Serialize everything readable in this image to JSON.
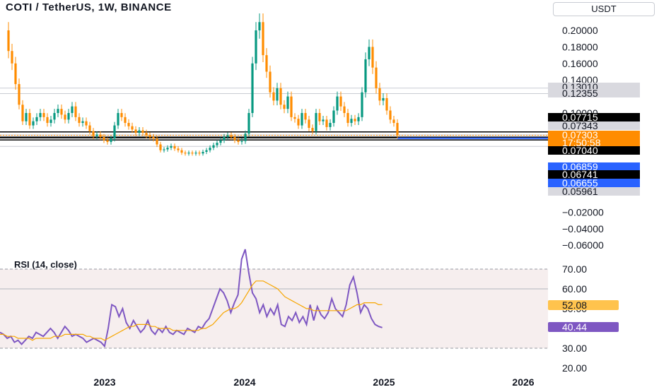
{
  "header": {
    "title": "COTI / TetherUS, 1W, BINANCE",
    "currency": "USDT"
  },
  "rsi": {
    "title": "RSI (14, close)"
  },
  "chart_data": [
    {
      "type": "candlestick",
      "title": "COTI / TetherUS, 1W, BINANCE",
      "ylabel": "USDT",
      "ylim": [
        -0.06,
        0.21
      ],
      "y_ticks": [
        "0.20000",
        "0.18000",
        "0.16000",
        "0.14000",
        "0.10000",
        "−0.02000",
        "−0.04000",
        "−0.06000"
      ],
      "x_ticks": [
        "2023",
        "2024",
        "2025",
        "2026"
      ],
      "up_color": "#089981",
      "down_color": "#ff8c00",
      "weekly_close": [
        0.175,
        0.16,
        0.135,
        0.11,
        0.09,
        0.1,
        0.085,
        0.09,
        0.095,
        0.1,
        0.095,
        0.088,
        0.092,
        0.1,
        0.105,
        0.098,
        0.092,
        0.1,
        0.108,
        0.095,
        0.088,
        0.09,
        0.085,
        0.078,
        0.072,
        0.074,
        0.071,
        0.067,
        0.065,
        0.069,
        0.085,
        0.1,
        0.095,
        0.088,
        0.084,
        0.08,
        0.076,
        0.079,
        0.076,
        0.073,
        0.071,
        0.069,
        0.062,
        0.055,
        0.056,
        0.058,
        0.06,
        0.057,
        0.055,
        0.052,
        0.051,
        0.052,
        0.051,
        0.052,
        0.051,
        0.053,
        0.055,
        0.058,
        0.061,
        0.064,
        0.067,
        0.071,
        0.073,
        0.071,
        0.067,
        0.065,
        0.066,
        0.075,
        0.1,
        0.16,
        0.2,
        0.21,
        0.17,
        0.15,
        0.125,
        0.115,
        0.13,
        0.11,
        0.105,
        0.12,
        0.095,
        0.093,
        0.085,
        0.1,
        0.092,
        0.082,
        0.078,
        0.1,
        0.09,
        0.092,
        0.083,
        0.088,
        0.103,
        0.12,
        0.108,
        0.1,
        0.088,
        0.093,
        0.09,
        0.095,
        0.125,
        0.165,
        0.18,
        0.155,
        0.13,
        0.115,
        0.118,
        0.103,
        0.092,
        0.088,
        0.073
      ],
      "horizontal_levels": [
        {
          "value": "0.13010",
          "color": "#d9d9df",
          "text_color": "#131722"
        },
        {
          "value": "0.12355",
          "color": "#d9d9df",
          "text_color": "#131722"
        },
        {
          "value": "0.07715",
          "color": "#000000",
          "text_color": "#ffffff"
        },
        {
          "value": "0.07343",
          "color": "#d9d9df",
          "text_color": "#131722"
        },
        {
          "value": "0.07303",
          "color": "#ff8c00",
          "text_color": "#ffffff",
          "sub": "17:50:58"
        },
        {
          "value": "0.07040",
          "color": "#000000",
          "text_color": "#ffffff"
        },
        {
          "value": "0.06859",
          "color": "#2962ff",
          "text_color": "#ffffff"
        },
        {
          "value": "0.06741",
          "color": "#000000",
          "text_color": "#ffffff"
        },
        {
          "value": "0.06655",
          "color": "#2962ff",
          "text_color": "#ffffff"
        },
        {
          "value": "0.05961",
          "color": "#d9d9df",
          "text_color": "#131722"
        }
      ]
    },
    {
      "type": "line",
      "title": "RSI (14, close)",
      "ylim": [
        20,
        75
      ],
      "y_ticks": [
        "70.00",
        "60.00",
        "30.00",
        "20.00"
      ],
      "band": [
        30,
        70
      ],
      "midline": 60,
      "series": [
        {
          "color": "#7e57c2",
          "values": [
            38,
            37,
            35,
            36,
            33,
            34,
            32,
            34,
            36,
            35,
            38,
            37,
            36,
            38,
            40,
            38,
            35,
            38,
            41,
            39,
            36,
            37,
            36,
            35,
            33,
            34,
            35,
            34,
            33,
            31,
            40,
            52,
            51,
            46,
            50,
            43,
            40,
            44,
            41,
            38,
            40,
            44,
            39,
            37,
            40,
            38,
            41,
            38,
            37,
            39,
            38,
            37,
            40,
            39,
            38,
            41,
            40,
            43,
            45,
            50,
            55,
            60,
            58,
            54,
            48,
            53,
            57,
            75,
            80,
            68,
            58,
            55,
            48,
            52,
            46,
            50,
            47,
            52,
            42,
            41,
            46,
            44,
            48,
            43,
            46,
            42,
            52,
            44,
            51,
            47,
            45,
            48,
            55,
            50,
            48,
            46,
            52,
            62,
            66,
            58,
            48,
            52,
            50,
            45,
            42,
            41,
            40.44
          ]
        },
        {
          "color": "#f7a600",
          "values": [
            37,
            37,
            36,
            36,
            36,
            35,
            35,
            35,
            35,
            34,
            35,
            35,
            35,
            35,
            35,
            36,
            36,
            36,
            37,
            37,
            37,
            37,
            37,
            37,
            36,
            36,
            35,
            35,
            35,
            34,
            35,
            36,
            37,
            38,
            39,
            40,
            41,
            41,
            42,
            42,
            42,
            42,
            41,
            41,
            40,
            40,
            40,
            40,
            39,
            39,
            39,
            39,
            39,
            39,
            39,
            39,
            40,
            40,
            41,
            42,
            44,
            46,
            48,
            49,
            50,
            50,
            51,
            53,
            56,
            59,
            62,
            64,
            64,
            64,
            63,
            62,
            61,
            60,
            58,
            56,
            55,
            54,
            53,
            52,
            51,
            50,
            50,
            49,
            49,
            49,
            49,
            49,
            49,
            49,
            49,
            49,
            49,
            50,
            51,
            52,
            52,
            53,
            53,
            53,
            53,
            52,
            52.08
          ]
        }
      ],
      "last_values": [
        {
          "value": "52.08",
          "color": "#ffc34d",
          "text_color": "#131722"
        },
        {
          "value": "40.44",
          "color": "#7e57c2",
          "text_color": "#ffffff"
        }
      ]
    }
  ]
}
